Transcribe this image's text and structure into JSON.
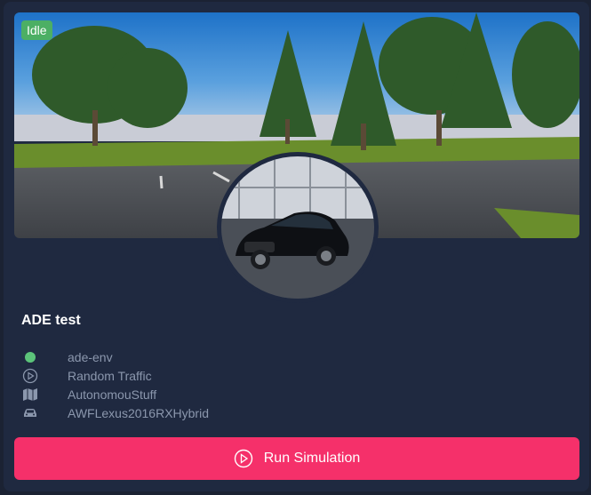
{
  "card": {
    "status": "Idle",
    "title": "ADE test",
    "details": [
      {
        "icon": "status-dot-icon",
        "label": "ade-env"
      },
      {
        "icon": "play-circle-icon",
        "label": "Random Traffic"
      },
      {
        "icon": "map-icon",
        "label": "AutonomouStuff"
      },
      {
        "icon": "car-icon",
        "label": "AWFLexus2016RXHybrid"
      }
    ],
    "run_button": {
      "label": "Run Simulation"
    }
  },
  "colors": {
    "background": "#1b2233",
    "card": "#1f2940",
    "status_green": "#4caf64",
    "env_dot": "#5cc47a",
    "accent": "#f5306a",
    "muted_text": "#8b97ad"
  }
}
